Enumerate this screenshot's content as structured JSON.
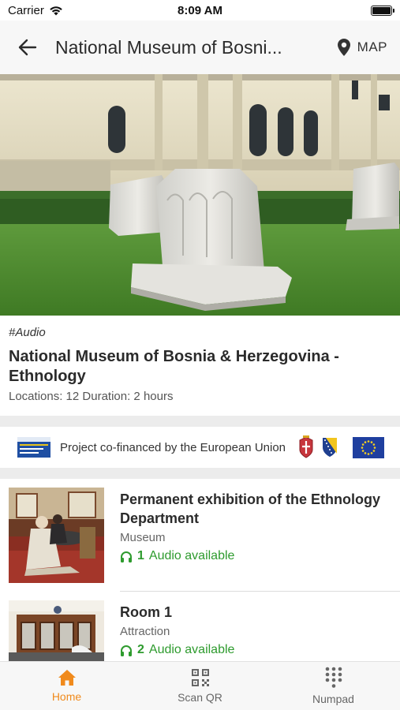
{
  "status_bar": {
    "carrier": "Carrier",
    "time": "8:09 AM"
  },
  "nav": {
    "title": "National Museum of Bosni...",
    "map_label": "MAP"
  },
  "tour": {
    "tag": "#Audio",
    "title": "National Museum of Bosnia & Herzegovina - Ethnology",
    "meta": "Locations: 12 Duration: 2 hours"
  },
  "banner": {
    "text": "Project co-financed by the European Union"
  },
  "items": [
    {
      "title": "Permanent exhibition of the Ethnology Department",
      "type": "Museum",
      "audio_count": "1",
      "audio_label": "Audio available"
    },
    {
      "title": "Room 1",
      "type": "Attraction",
      "audio_count": "2",
      "audio_label": "Audio available"
    }
  ],
  "tabs": [
    {
      "label": "Home",
      "icon": "home-icon",
      "active": true
    },
    {
      "label": "Scan QR",
      "icon": "qr-code-icon",
      "active": false
    },
    {
      "label": "Numpad",
      "icon": "numpad-icon",
      "active": false
    }
  ],
  "colors": {
    "accent": "#f08a1c",
    "audio_green": "#2e9b2e",
    "nav_bg": "#f7f7f7"
  }
}
